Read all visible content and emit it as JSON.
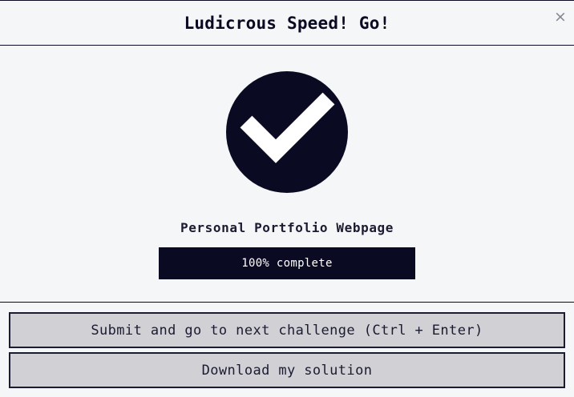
{
  "modal": {
    "title": "Ludicrous Speed! Go!",
    "close_label": "×"
  },
  "completion": {
    "icon": "checkmark-circle-icon",
    "project_name": "Personal Portfolio Webpage",
    "progress_percent": 100,
    "progress_label": "100% complete"
  },
  "actions": {
    "submit_label": "Submit and go to next challenge (Ctrl + Enter)",
    "download_label": "Download my solution"
  },
  "colors": {
    "dark": "#0a0a23",
    "background": "#f5f6f7",
    "button_bg": "#d0d0d5"
  }
}
